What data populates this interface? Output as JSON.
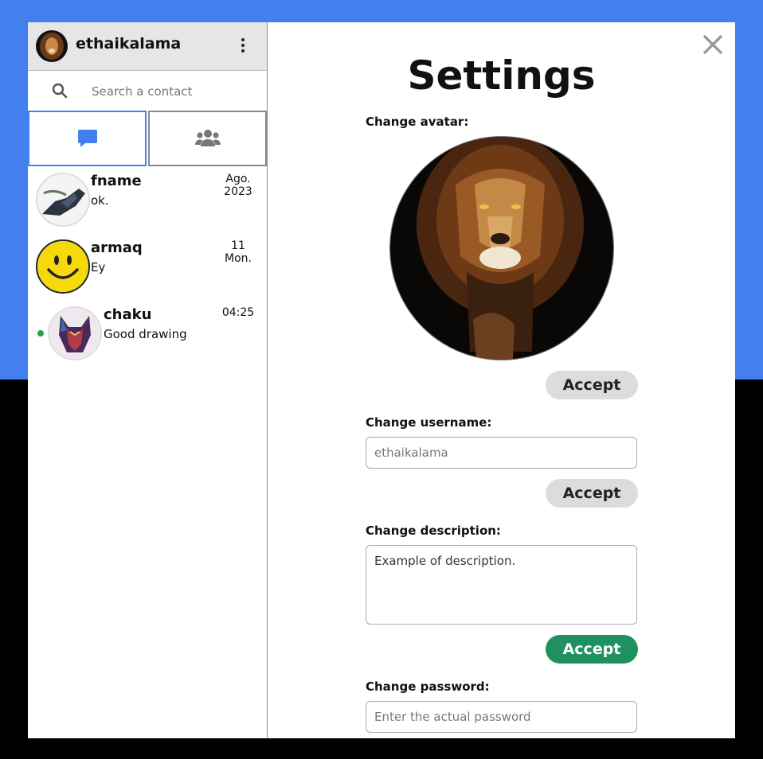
{
  "user": {
    "name": "ethaikalama"
  },
  "search": {
    "placeholder": "Search a contact"
  },
  "tabs": [
    {
      "icon": "chat-bubble-icon",
      "active": true
    },
    {
      "icon": "users-icon",
      "active": false
    }
  ],
  "chats": [
    {
      "name": "fname",
      "message": "ok.",
      "date_line1": "Ago.",
      "date_line2": "2023",
      "online": false
    },
    {
      "name": "armaq",
      "message": "Ey",
      "date_line1": "11",
      "date_line2": "Mon.",
      "online": false
    },
    {
      "name": "chaku",
      "message": "Good drawing",
      "date_line1": "04:25",
      "date_line2": "",
      "online": true
    }
  ],
  "settings": {
    "title": "Settings",
    "avatar_label": "Change avatar:",
    "username_label": "Change username:",
    "username_placeholder": "ethaikalama",
    "description_label": "Change description:",
    "description_value": "Example of description.",
    "password_label": "Change password:",
    "password_placeholder": "Enter the actual password",
    "accept_label": "Accept"
  },
  "colors": {
    "accent": "#4280ef",
    "accept_green": "#1f9060",
    "online": "#25a244"
  }
}
